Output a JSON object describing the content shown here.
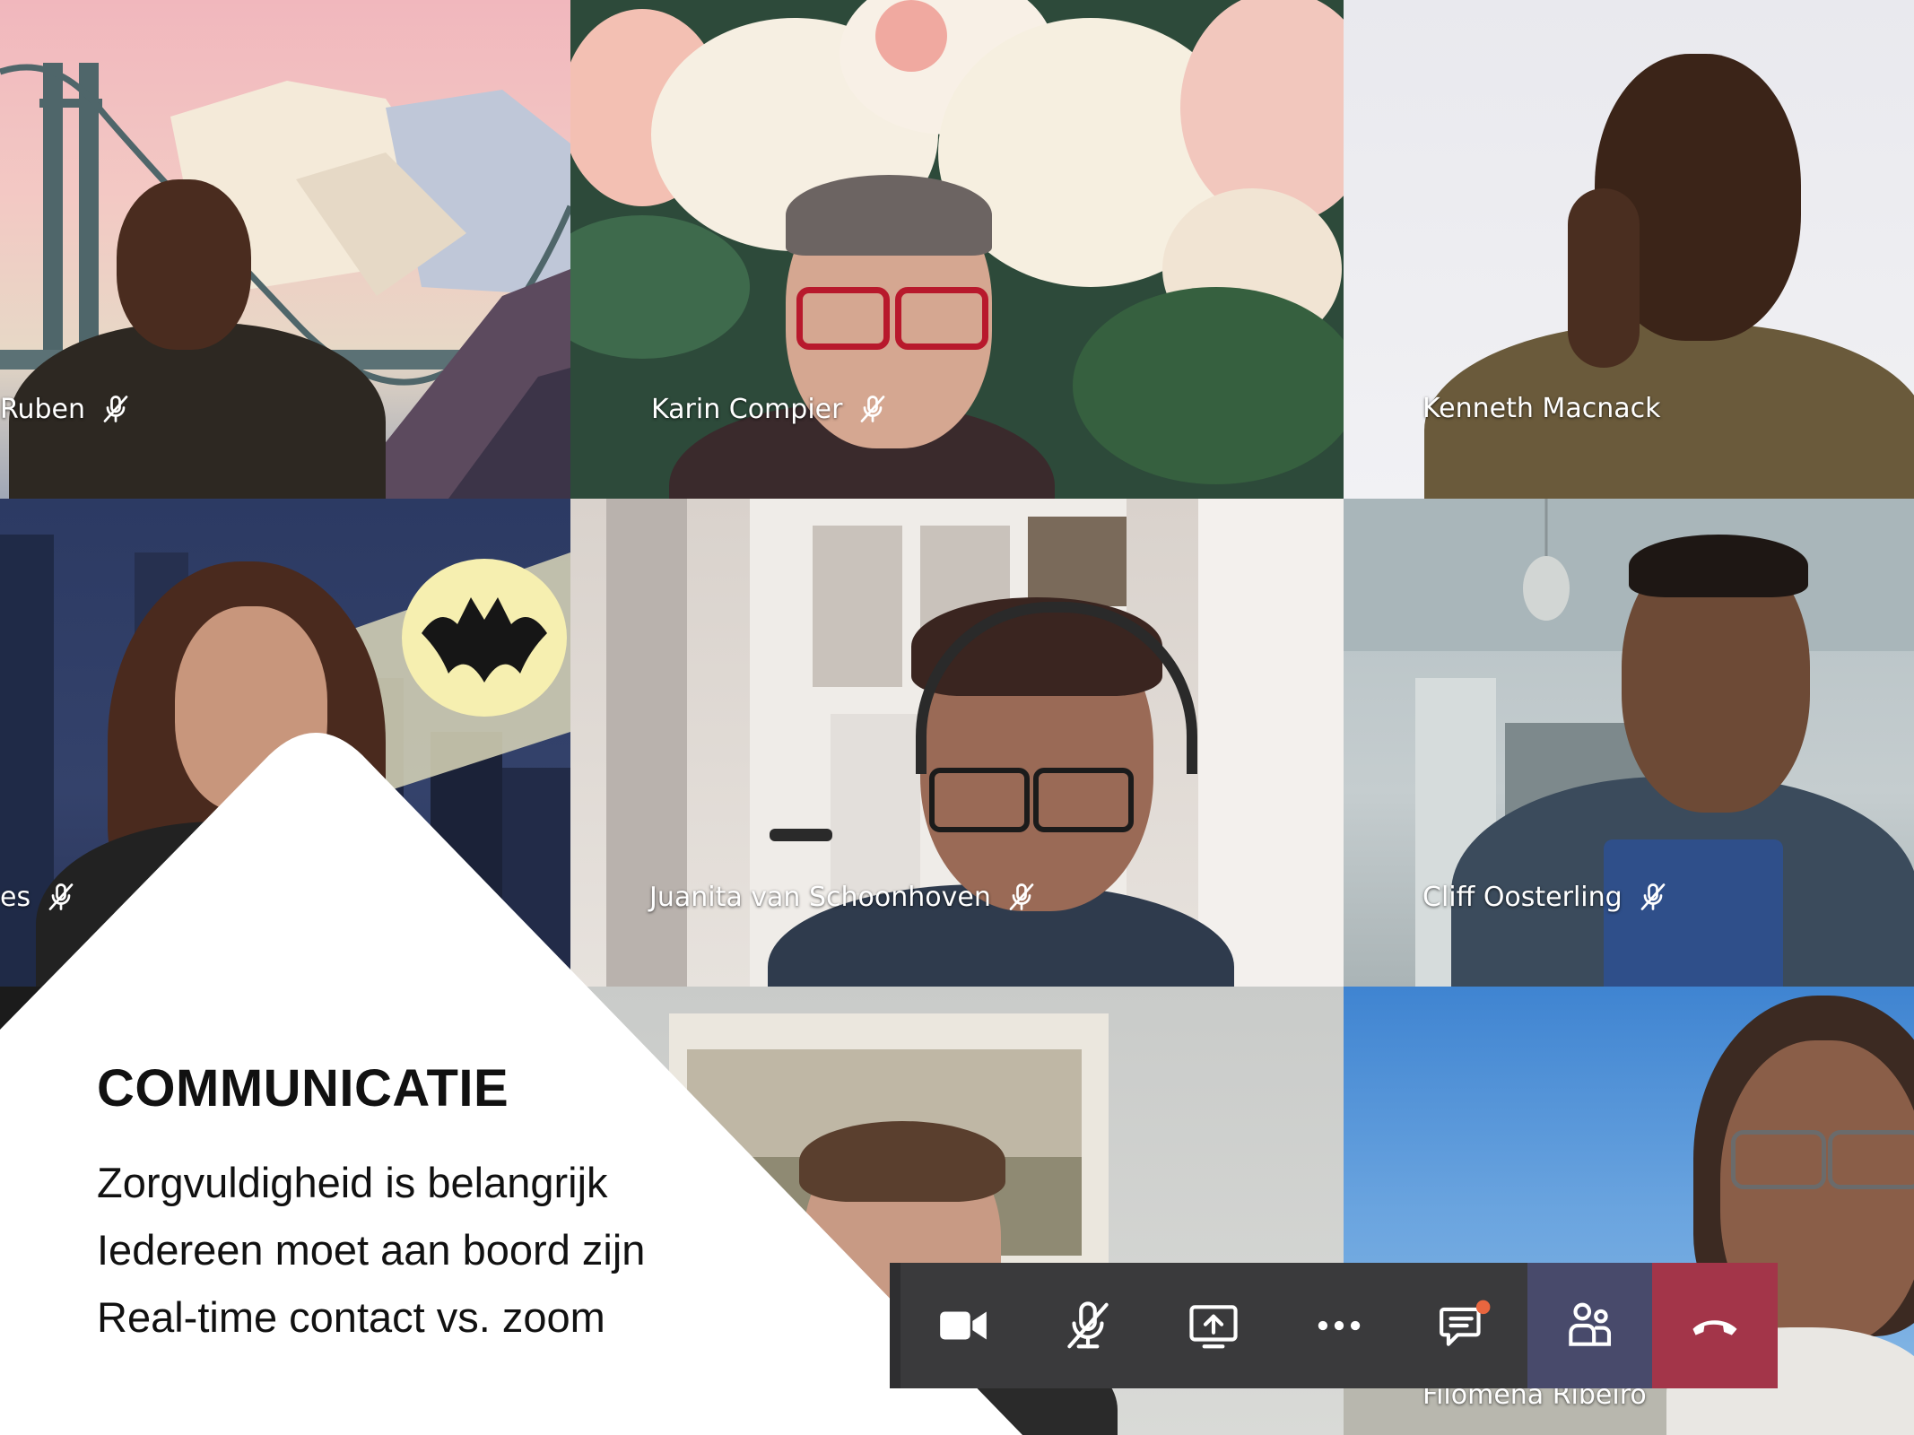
{
  "slide": {
    "title": "COMMUNICATIE",
    "lines": [
      "Zorgvuldigheid is belangrijk",
      "Iedereen moet aan boord zijn",
      "Real-time contact vs. zoom"
    ]
  },
  "participants": [
    {
      "name": "Ruben",
      "muted": true
    },
    {
      "name": "Karin Compier",
      "muted": true
    },
    {
      "name": "Kenneth Macnack",
      "muted": false
    },
    {
      "name": "es",
      "muted": true
    },
    {
      "name": "Juanita van Schoonhoven",
      "muted": true
    },
    {
      "name": "Cliff Oosterling",
      "muted": true
    },
    {
      "name": "",
      "muted": false
    },
    {
      "name": "Filomena Ribeiro",
      "muted": false
    }
  ],
  "toolbar": {
    "buttons": [
      "camera-icon",
      "mic-off-icon",
      "share-screen-icon",
      "more-icon",
      "chat-icon",
      "participants-icon",
      "hang-up-icon"
    ],
    "colors": {
      "button": "#3a3a3c",
      "participants": "#484a6b",
      "leave": "#a33549",
      "notification": "#e8663f"
    }
  }
}
